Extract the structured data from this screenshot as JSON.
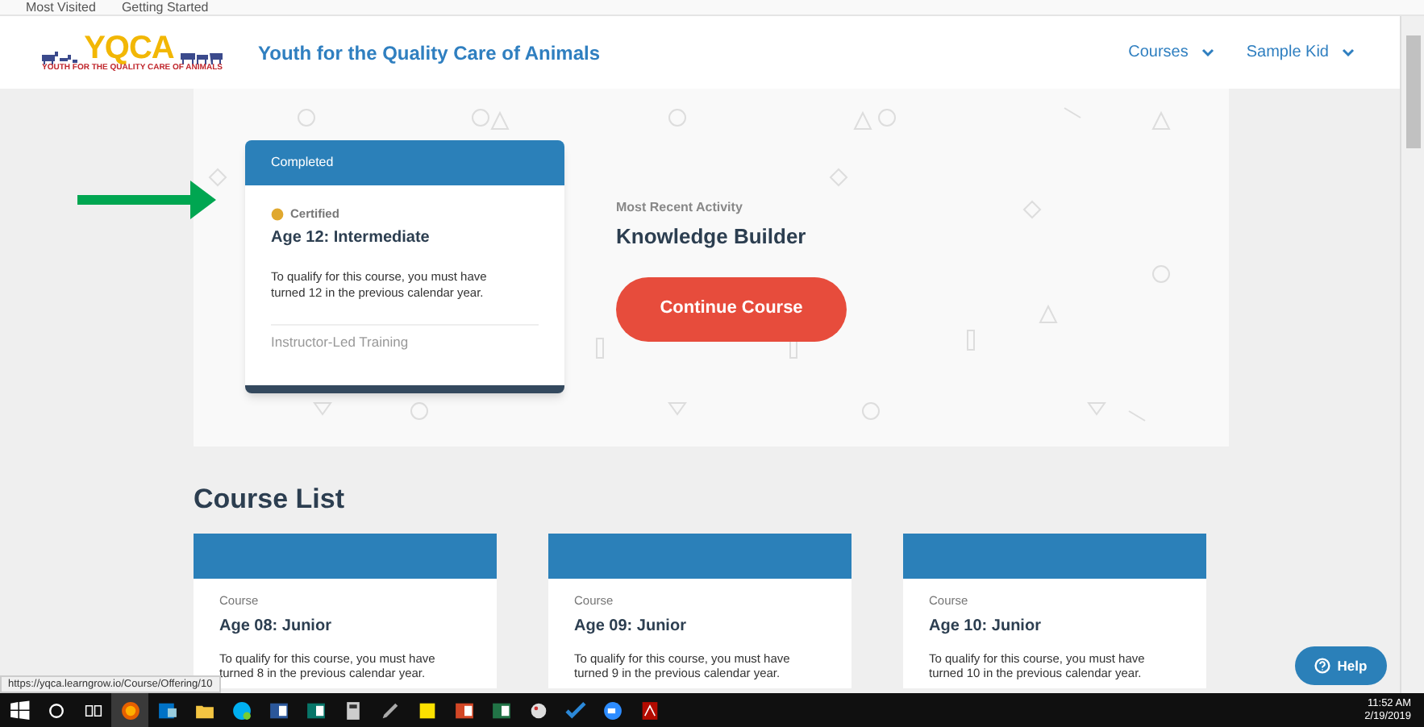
{
  "bookmarks": [
    {
      "label": "Most Visited"
    },
    {
      "label": "Getting Started"
    }
  ],
  "header": {
    "logo": {
      "title": "YQCA",
      "subtitle": "YOUTH FOR THE QUALITY CARE OF ANIMALS"
    },
    "site_title": "Youth for the Quality Care of Animals",
    "nav": [
      {
        "label": "Courses"
      },
      {
        "label": "Sample Kid"
      }
    ]
  },
  "featured": {
    "status": "Completed",
    "badge": "Certified",
    "title": "Age 12: Intermediate",
    "description": "To qualify for this course, you must have turned 12 in the previous calendar year.",
    "footer": "Instructor-Led Training",
    "activity_label": "Most Recent Activity",
    "activity": "Knowledge Builder",
    "button": "Continue Course"
  },
  "course_list": {
    "heading": "Course List",
    "courses": [
      {
        "label": "Course",
        "title": "Age 08: Junior",
        "description": "To qualify for this course, you must have turned 8 in the previous calendar year."
      },
      {
        "label": "Course",
        "title": "Age 09: Junior",
        "description": "To qualify for this course, you must have turned 9 in the previous calendar year."
      },
      {
        "label": "Course",
        "title": "Age 10: Junior",
        "description": "To qualify for this course, you must have turned 10 in the previous calendar year."
      }
    ]
  },
  "help": {
    "label": "Help"
  },
  "status_url": "https://yqca.learngrow.io/Course/Offering/10",
  "taskbar": {
    "time": "11:52 AM",
    "date": "2/19/2019"
  }
}
